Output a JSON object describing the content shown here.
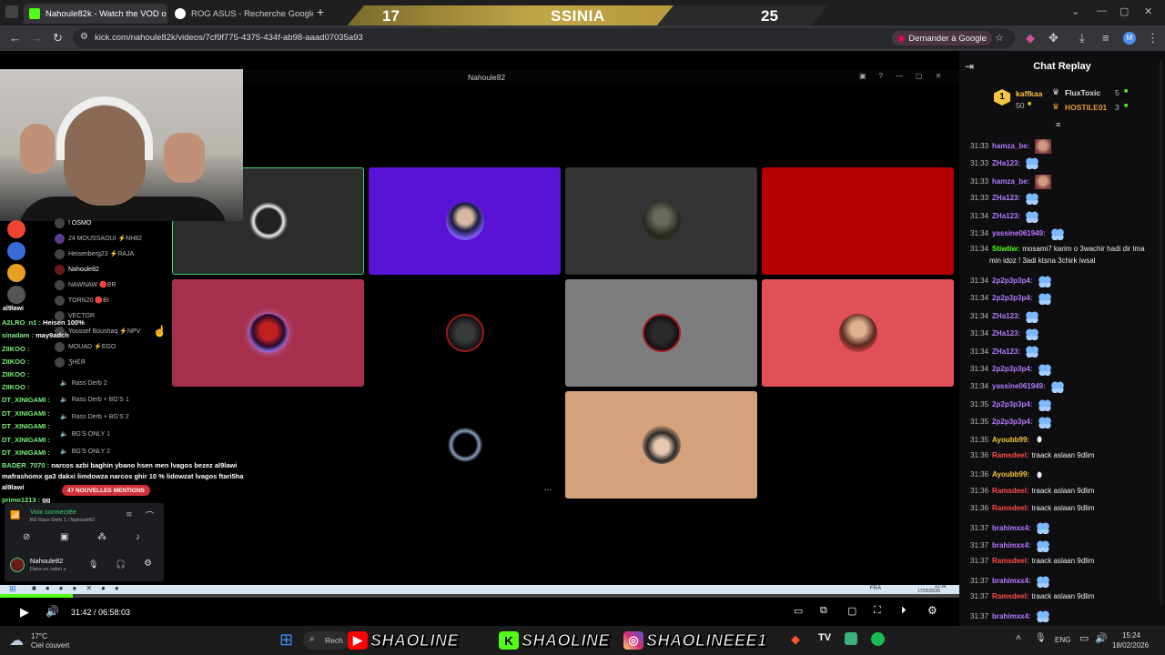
{
  "browser": {
    "tabs": [
      {
        "label": "Nahoule82k - Watch the VOD o",
        "favicon_color": "#53fc18"
      },
      {
        "label": "ROG ASUS - Recherche Google",
        "favicon_color": "#4285f4"
      }
    ],
    "new_tab": "+",
    "url": "kick.com/nahoule82k/videos/7cf9f775-4375-434f-ab98-aaad07035a93",
    "ask_google": "Demander à Google",
    "profile_initial": "M"
  },
  "scoreboard": {
    "left_score": "17",
    "team": "SSINIA",
    "right_score": "25"
  },
  "discord": {
    "window_title": "Nahoule82",
    "voice_members": [
      "! OSMO",
      "24 MOUSSAOUI ⚡NH82",
      "Heisenberg23 ⚡RAJA",
      "Nahoule82",
      "NAWNAW 🔴BR",
      "TORN20 🔴BI",
      "VECTOR",
      "Youssef Boushaq ⚡NPV",
      "MOUAD ⚡EGO",
      "ƷHƐЯ",
      "Rass Derb 2",
      "Rass Derb + BG'S 1",
      "Rass Derb + BG'S 2",
      "BG'S ONLY 1",
      "BG'S ONLY 2"
    ],
    "chat_lines": [
      {
        "user": "A2LRO_n1 :",
        "text": "Heisen 100%"
      },
      {
        "user": "sinadam :",
        "text": "may9adch"
      },
      {
        "user": "ZIIKOO :",
        "text": ""
      },
      {
        "user": "ZIIKOO :",
        "text": ""
      },
      {
        "user": "ZIIKOO :",
        "text": ""
      },
      {
        "user": "ZIIKOO :",
        "text": ""
      },
      {
        "user": "DT_XINIGAMI :",
        "text": ""
      },
      {
        "user": "DT_XINIGAMI :",
        "text": ""
      },
      {
        "user": "DT_XINIGAMI :",
        "text": ""
      },
      {
        "user": "DT_XINIGAMI :",
        "text": ""
      },
      {
        "user": "DT_XINIGAMI :",
        "text": ""
      },
      {
        "user": "BADER_7070 :",
        "text": "narcos azbi baghin ybano hsen men lvagos bezez al9lawi"
      },
      {
        "user": "",
        "text": "mafrashomx ga3 dakxi limdowza narcos ghir 10 % lidowzat lvagos ftari5ha"
      },
      {
        "user": "",
        "text": "al9lawi"
      },
      {
        "user": "primo1213 :",
        "text": "gg"
      }
    ],
    "side_label": "al9lawi",
    "mentions": "47 NOUVELLES MENTIONS",
    "voice_connected": "Voix connectée",
    "voice_channel": "BD Rass Derb 1 / Nahoule82",
    "user_name": "Nahoule82",
    "user_status": "Dans un salon v",
    "tile_more": "..."
  },
  "player": {
    "timecode": "31:42 / 06:58:03",
    "progress": 0.076
  },
  "inner_taskbar": {
    "lang": "FRA",
    "time": "22:36",
    "date": "17/02/2026"
  },
  "chat_replay": {
    "title": "Chat Replay",
    "podium": {
      "first": {
        "rank": "1",
        "name": "kaffkaa",
        "score": "50"
      },
      "second": {
        "name": "FluxToxic",
        "score": "5"
      },
      "third": {
        "name": "HOSTILE01",
        "score": "3"
      }
    },
    "messages": [
      {
        "time": "31:33",
        "user": "hamza_be:",
        "text": "",
        "color": "#b57bff",
        "emote": "face"
      },
      {
        "time": "31:33",
        "user": "ZHa123:",
        "text": "",
        "color": "#b57bff",
        "emote": "butterfly"
      },
      {
        "time": "31:33",
        "user": "hamza_be:",
        "text": "",
        "color": "#b57bff",
        "emote": "face"
      },
      {
        "time": "31:33",
        "user": "ZHa123:",
        "text": "",
        "color": "#b57bff",
        "emote": "butterfly"
      },
      {
        "time": "31:34",
        "user": "ZHa123:",
        "text": "",
        "color": "#b57bff",
        "emote": "butterfly"
      },
      {
        "time": "31:34",
        "user": "yassine061949:",
        "text": "",
        "color": "#b57bff",
        "emote": "butterfly"
      },
      {
        "time": "31:34",
        "user": "Stiwtiw:",
        "text": "mosami7 karim o 3wachir hadi dir lma",
        "color": "#53fc18",
        "emote": ""
      },
      {
        "time": "",
        "user": "",
        "text": "min idoz ! 3adi ktsna 3chirk iwsal",
        "color": "#53fc18",
        "emote": ""
      },
      {
        "time": "31:34",
        "user": "2p2p3p3p4:",
        "text": "",
        "color": "#b57bff",
        "emote": "butterfly"
      },
      {
        "time": "31:34",
        "user": "2p2p3p3p4:",
        "text": "",
        "color": "#b57bff",
        "emote": "butterfly"
      },
      {
        "time": "31:34",
        "user": "ZHa123:",
        "text": "",
        "color": "#b57bff",
        "emote": "butterfly"
      },
      {
        "time": "31:34",
        "user": "ZHa123:",
        "text": "",
        "color": "#b57bff",
        "emote": "butterfly"
      },
      {
        "time": "31:34",
        "user": "ZHa123:",
        "text": "",
        "color": "#b57bff",
        "emote": "butterfly"
      },
      {
        "time": "31:34",
        "user": "2p2p3p3p4:",
        "text": "",
        "color": "#b57bff",
        "emote": "butterfly"
      },
      {
        "time": "31:34",
        "user": "yassine061949:",
        "text": "",
        "color": "#b57bff",
        "emote": "butterfly"
      },
      {
        "time": "31:35",
        "user": "2p2p3p3p4:",
        "text": "",
        "color": "#b57bff",
        "emote": "butterfly"
      },
      {
        "time": "31:35",
        "user": "2p2p3p3p4:",
        "text": "",
        "color": "#b57bff",
        "emote": "butterfly"
      },
      {
        "time": "31:35",
        "user": "Ayoubb99:",
        "text": "",
        "color": "#f5c542",
        "emote": "leaf"
      },
      {
        "time": "31:36",
        "user": "Ramsdeel:",
        "text": "traack aslaan 9dlim",
        "color": "#ff4d4d",
        "emote": ""
      },
      {
        "time": "31:36",
        "user": "Ayoubb99:",
        "text": "",
        "color": "#f5c542",
        "emote": "leaf"
      },
      {
        "time": "31:36",
        "user": "Ramsdeel:",
        "text": "traack aslaan 9dlim",
        "color": "#ff4d4d",
        "emote": ""
      },
      {
        "time": "31:36",
        "user": "Ramsdeel:",
        "text": "traack aslaan 9dlim",
        "color": "#ff4d4d",
        "emote": ""
      },
      {
        "time": "31:37",
        "user": "brahimxx4:",
        "text": "",
        "color": "#b57bff",
        "emote": "butterfly"
      },
      {
        "time": "31:37",
        "user": "brahimxx4:",
        "text": "",
        "color": "#b57bff",
        "emote": "butterfly"
      },
      {
        "time": "31:37",
        "user": "Ramsdeel:",
        "text": "traack aslaan 9dlim",
        "color": "#ff4d4d",
        "emote": ""
      },
      {
        "time": "31:37",
        "user": "brahimxx4:",
        "text": "",
        "color": "#b57bff",
        "emote": "butterfly"
      },
      {
        "time": "31:37",
        "user": "Ramsdeel:",
        "text": "traack aslaan 9dlim",
        "color": "#ff4d4d",
        "emote": ""
      },
      {
        "time": "31:37",
        "user": "brahimxx4:",
        "text": "",
        "color": "#b57bff",
        "emote": "butterfly"
      }
    ]
  },
  "taskbar": {
    "weather_temp": "17°C",
    "weather_desc": "Ciel couvert",
    "search": "Rech",
    "brands": [
      {
        "platform": "youtube",
        "name": "SHAOLINE",
        "color": "#ff0000"
      },
      {
        "platform": "kick",
        "name": "SHAOLINE",
        "color": "#53fc18"
      },
      {
        "platform": "instagram",
        "name": "SHAOLINEEE1",
        "color": "#d62976"
      }
    ],
    "lang": "ENG",
    "time": "15:24",
    "date": "18/02/2026"
  },
  "colors": {
    "kick_green": "#53fc18",
    "chat_bg": "#0e0e10"
  }
}
